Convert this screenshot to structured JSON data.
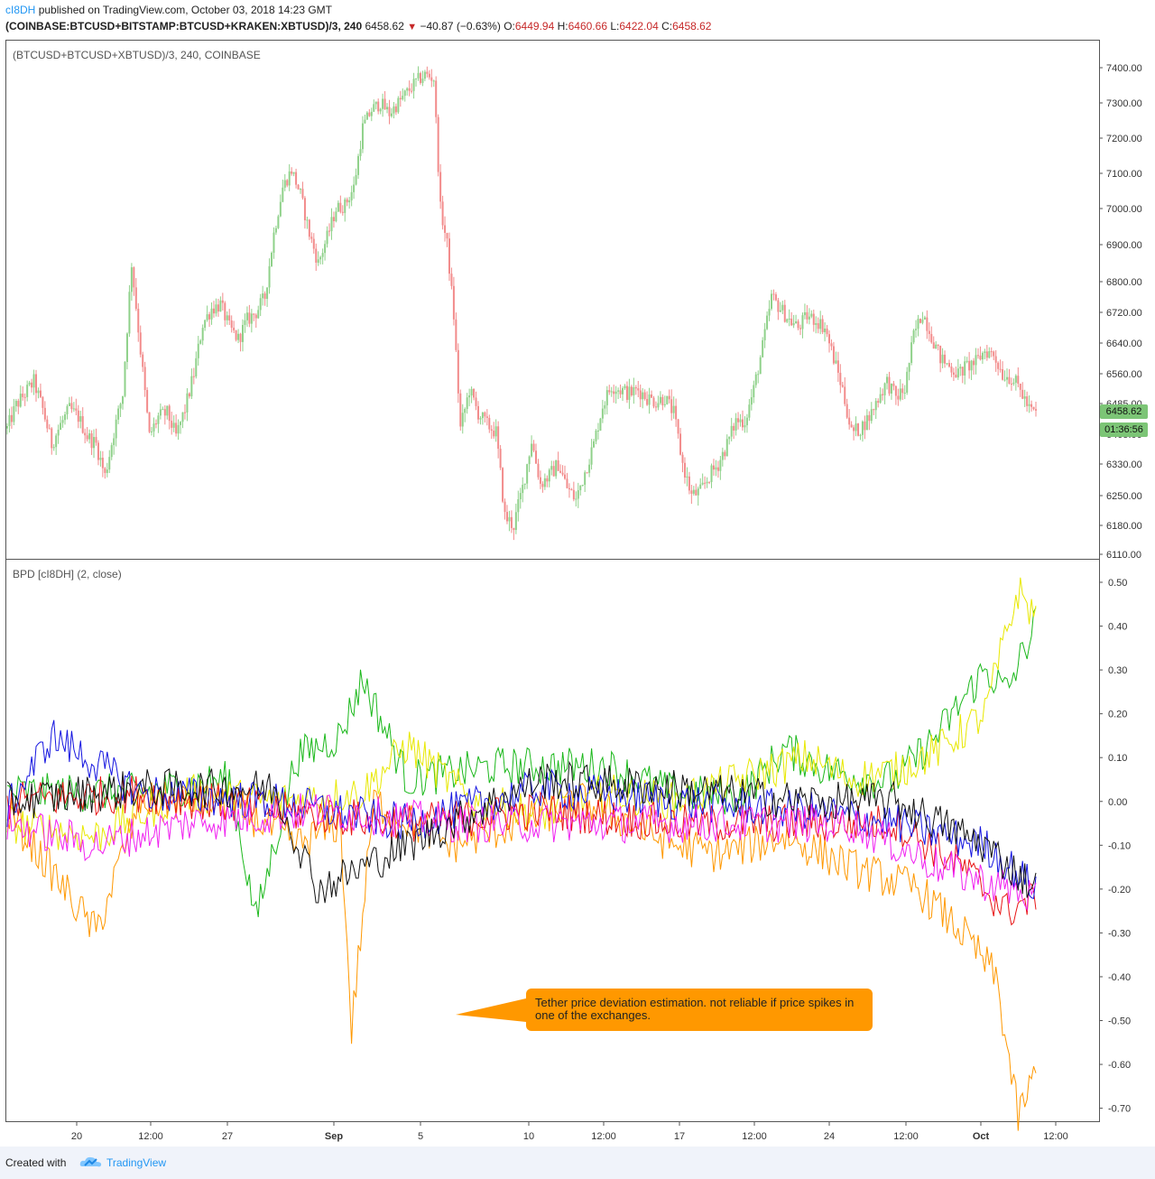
{
  "header": {
    "author": "cI8DH",
    "published_text": "published on TradingView.com, October 03, 2018 14:23 GMT",
    "symbol": "(COINBASE:BTCUSD+BITSTAMP:BTCUSD+KRAKEN:XBTUSD)/3, 240",
    "last": "6458.62",
    "change": "−40.87 (−0.63%)",
    "o_label": "O:",
    "o_value": "6449.94",
    "h_label": "H:",
    "h_value": "6460.66",
    "l_label": "L:",
    "l_value": "6422.04",
    "c_label": "C:",
    "c_value": "6458.62"
  },
  "price_pane": {
    "label": "(BTCUSD+BTCUSD+XBTUSD)/3, 240, COINBASE",
    "last_price_badge": "6458.62",
    "countdown_badge": "01:36:56"
  },
  "indicator_pane": {
    "label": "BPD [cI8DH] (2, close)",
    "annotation": "Tether price deviation estimation. not reliable if price spikes in one of the exchanges."
  },
  "footer": {
    "created_with": "Created with",
    "brand": "TradingView"
  },
  "colors": {
    "up": "#8fd18a",
    "down": "#f28b8b",
    "callout": "#ff9800",
    "green_line": "#1bb81b",
    "yellow_line": "#e8e800",
    "orange_line": "#ff9800",
    "red_line": "#e81414",
    "blue_line": "#1414e0",
    "magenta_line": "#f020f0",
    "black_line": "#111111"
  },
  "chart_data": [
    {
      "type": "candlestick",
      "title": "(BTCUSD+BTCUSD+XBTUSD)/3, 240, COINBASE",
      "ylim": [
        6090,
        7430
      ],
      "y_ticks": [
        "7400.00",
        "7300.00",
        "7200.00",
        "7100.00",
        "7000.00",
        "6900.00",
        "6800.00",
        "6720.00",
        "6640.00",
        "6560.00",
        "6485.00",
        "6405.00",
        "6330.00",
        "6250.00",
        "6180.00",
        "6110.00"
      ],
      "y_tick_values": [
        7400,
        7300,
        7200,
        7100,
        7000,
        6900,
        6800,
        6720,
        6640,
        6560,
        6485,
        6405,
        6330,
        6250,
        6180,
        6110
      ],
      "x_ticks": [
        "20",
        "12:00",
        "27",
        "Sep",
        "5",
        "10",
        "12:00",
        "17",
        "12:00",
        "24",
        "12:00",
        "Oct",
        "12:00"
      ],
      "close_path": [
        [
          0,
          6420
        ],
        [
          4,
          6480
        ],
        [
          8,
          6510
        ],
        [
          12,
          6540
        ],
        [
          16,
          6470
        ],
        [
          20,
          6380
        ],
        [
          24,
          6430
        ],
        [
          28,
          6470
        ],
        [
          32,
          6450
        ],
        [
          36,
          6400
        ],
        [
          40,
          6380
        ],
        [
          44,
          6300
        ],
        [
          48,
          6410
        ],
        [
          52,
          6510
        ],
        [
          56,
          6850
        ],
        [
          60,
          6620
        ],
        [
          64,
          6400
        ],
        [
          68,
          6450
        ],
        [
          72,
          6460
        ],
        [
          76,
          6400
        ],
        [
          80,
          6470
        ],
        [
          84,
          6560
        ],
        [
          88,
          6690
        ],
        [
          92,
          6730
        ],
        [
          96,
          6740
        ],
        [
          100,
          6680
        ],
        [
          104,
          6650
        ],
        [
          108,
          6700
        ],
        [
          112,
          6720
        ],
        [
          116,
          6760
        ],
        [
          120,
          6930
        ],
        [
          124,
          7060
        ],
        [
          128,
          7110
        ],
        [
          132,
          7040
        ],
        [
          136,
          6930
        ],
        [
          140,
          6850
        ],
        [
          144,
          6920
        ],
        [
          148,
          7000
        ],
        [
          152,
          7010
        ],
        [
          156,
          7060
        ],
        [
          160,
          7230
        ],
        [
          164,
          7280
        ],
        [
          168,
          7300
        ],
        [
          172,
          7270
        ],
        [
          176,
          7300
        ],
        [
          180,
          7330
        ],
        [
          184,
          7360
        ],
        [
          188,
          7380
        ],
        [
          192,
          7370
        ],
        [
          195,
          7000
        ],
        [
          198,
          6900
        ],
        [
          201,
          6710
        ],
        [
          204,
          6420
        ],
        [
          208,
          6520
        ],
        [
          212,
          6460
        ],
        [
          216,
          6430
        ],
        [
          220,
          6410
        ],
        [
          224,
          6200
        ],
        [
          228,
          6180
        ],
        [
          232,
          6270
        ],
        [
          236,
          6390
        ],
        [
          240,
          6280
        ],
        [
          244,
          6300
        ],
        [
          248,
          6330
        ],
        [
          252,
          6270
        ],
        [
          256,
          6240
        ],
        [
          260,
          6310
        ],
        [
          264,
          6380
        ],
        [
          268,
          6480
        ],
        [
          272,
          6530
        ],
        [
          276,
          6520
        ],
        [
          280,
          6510
        ],
        [
          284,
          6520
        ],
        [
          288,
          6500
        ],
        [
          292,
          6490
        ],
        [
          296,
          6500
        ],
        [
          300,
          6460
        ],
        [
          304,
          6330
        ],
        [
          308,
          6250
        ],
        [
          312,
          6260
        ],
        [
          316,
          6300
        ],
        [
          320,
          6330
        ],
        [
          324,
          6380
        ],
        [
          328,
          6440
        ],
        [
          332,
          6440
        ],
        [
          336,
          6520
        ],
        [
          340,
          6630
        ],
        [
          344,
          6760
        ],
        [
          348,
          6730
        ],
        [
          352,
          6700
        ],
        [
          356,
          6680
        ],
        [
          360,
          6710
        ],
        [
          364,
          6700
        ],
        [
          368,
          6680
        ],
        [
          372,
          6600
        ],
        [
          376,
          6520
        ],
        [
          380,
          6410
        ],
        [
          384,
          6420
        ],
        [
          388,
          6450
        ],
        [
          392,
          6500
        ],
        [
          396,
          6540
        ],
        [
          400,
          6500
        ],
        [
          404,
          6520
        ],
        [
          408,
          6660
        ],
        [
          412,
          6720
        ],
        [
          416,
          6660
        ],
        [
          420,
          6600
        ],
        [
          424,
          6580
        ],
        [
          428,
          6560
        ],
        [
          432,
          6580
        ],
        [
          436,
          6590
        ],
        [
          440,
          6620
        ],
        [
          444,
          6610
        ],
        [
          448,
          6560
        ],
        [
          452,
          6550
        ],
        [
          456,
          6520
        ],
        [
          460,
          6470
        ],
        [
          463,
          6458.62
        ]
      ]
    },
    {
      "type": "line",
      "title": "BPD [cI8DH] (2, close)",
      "ylim": [
        -0.74,
        0.52
      ],
      "y_ticks": [
        "0.50",
        "0.40",
        "0.30",
        "0.20",
        "0.10",
        "0.00",
        "-0.10",
        "-0.20",
        "-0.30",
        "-0.40",
        "-0.50",
        "-0.60",
        "-0.70"
      ],
      "y_tick_values": [
        0.5,
        0.4,
        0.3,
        0.2,
        0.1,
        0,
        -0.1,
        -0.2,
        -0.3,
        -0.4,
        -0.5,
        -0.6,
        -0.7
      ],
      "series": [
        {
          "color_key": "green_line",
          "anchors": [
            [
              0,
              0.02
            ],
            [
              60,
              0.02
            ],
            [
              100,
              0.05
            ],
            [
              112,
              -0.27
            ],
            [
              130,
              0.1
            ],
            [
              150,
              0.15
            ],
            [
              160,
              0.28
            ],
            [
              180,
              0.05
            ],
            [
              220,
              0.08
            ],
            [
              270,
              0.08
            ],
            [
              300,
              0.02
            ],
            [
              330,
              0.01
            ],
            [
              350,
              0.12
            ],
            [
              370,
              0.07
            ],
            [
              390,
              0.05
            ],
            [
              400,
              0.05
            ],
            [
              420,
              0.16
            ],
            [
              440,
              0.3
            ],
            [
              450,
              0.25
            ],
            [
              463,
              0.41
            ]
          ]
        },
        {
          "color_key": "yellow_line",
          "anchors": [
            [
              0,
              -0.05
            ],
            [
              40,
              -0.08
            ],
            [
              60,
              -0.03
            ],
            [
              80,
              0.02
            ],
            [
              120,
              0.0
            ],
            [
              160,
              0.02
            ],
            [
              180,
              0.13
            ],
            [
              210,
              0.0
            ],
            [
              240,
              -0.03
            ],
            [
              270,
              0.02
            ],
            [
              300,
              0.0
            ],
            [
              330,
              0.05
            ],
            [
              360,
              0.1
            ],
            [
              380,
              0.05
            ],
            [
              400,
              0.07
            ],
            [
              420,
              0.12
            ],
            [
              440,
              0.2
            ],
            [
              455,
              0.48
            ],
            [
              463,
              0.42
            ]
          ]
        },
        {
          "color_key": "orange_line",
          "anchors": [
            [
              0,
              -0.02
            ],
            [
              40,
              -0.3
            ],
            [
              60,
              0.0
            ],
            [
              100,
              0.0
            ],
            [
              130,
              -0.1
            ],
            [
              150,
              -0.05
            ],
            [
              155,
              -0.52
            ],
            [
              165,
              0.0
            ],
            [
              200,
              -0.1
            ],
            [
              230,
              -0.05
            ],
            [
              260,
              0.0
            ],
            [
              300,
              -0.1
            ],
            [
              320,
              -0.12
            ],
            [
              350,
              -0.08
            ],
            [
              380,
              -0.15
            ],
            [
              410,
              -0.2
            ],
            [
              430,
              -0.3
            ],
            [
              445,
              -0.4
            ],
            [
              455,
              -0.72
            ],
            [
              463,
              -0.62
            ]
          ]
        },
        {
          "color_key": "red_line",
          "anchors": [
            [
              0,
              0.0
            ],
            [
              60,
              0.02
            ],
            [
              120,
              -0.02
            ],
            [
              180,
              -0.05
            ],
            [
              240,
              -0.02
            ],
            [
              300,
              -0.05
            ],
            [
              360,
              -0.05
            ],
            [
              400,
              -0.05
            ],
            [
              430,
              -0.15
            ],
            [
              450,
              -0.25
            ],
            [
              463,
              -0.22
            ]
          ]
        },
        {
          "color_key": "blue_line",
          "anchors": [
            [
              0,
              -0.02
            ],
            [
              20,
              0.15
            ],
            [
              60,
              0.02
            ],
            [
              120,
              0.0
            ],
            [
              180,
              -0.05
            ],
            [
              240,
              0.03
            ],
            [
              300,
              0.0
            ],
            [
              360,
              -0.02
            ],
            [
              400,
              -0.05
            ],
            [
              440,
              -0.1
            ],
            [
              463,
              -0.2
            ]
          ]
        },
        {
          "color_key": "magenta_line",
          "anchors": [
            [
              0,
              -0.05
            ],
            [
              40,
              -0.1
            ],
            [
              80,
              -0.05
            ],
            [
              140,
              -0.02
            ],
            [
              200,
              -0.05
            ],
            [
              260,
              -0.05
            ],
            [
              320,
              -0.05
            ],
            [
              380,
              -0.05
            ],
            [
              420,
              -0.15
            ],
            [
              463,
              -0.22
            ]
          ]
        },
        {
          "color_key": "black_line",
          "anchors": [
            [
              0,
              0.0
            ],
            [
              60,
              0.03
            ],
            [
              120,
              0.03
            ],
            [
              140,
              -0.2
            ],
            [
              180,
              -0.1
            ],
            [
              240,
              0.05
            ],
            [
              300,
              0.03
            ],
            [
              360,
              0.0
            ],
            [
              400,
              0.0
            ],
            [
              440,
              -0.1
            ],
            [
              463,
              -0.2
            ]
          ]
        }
      ]
    }
  ]
}
